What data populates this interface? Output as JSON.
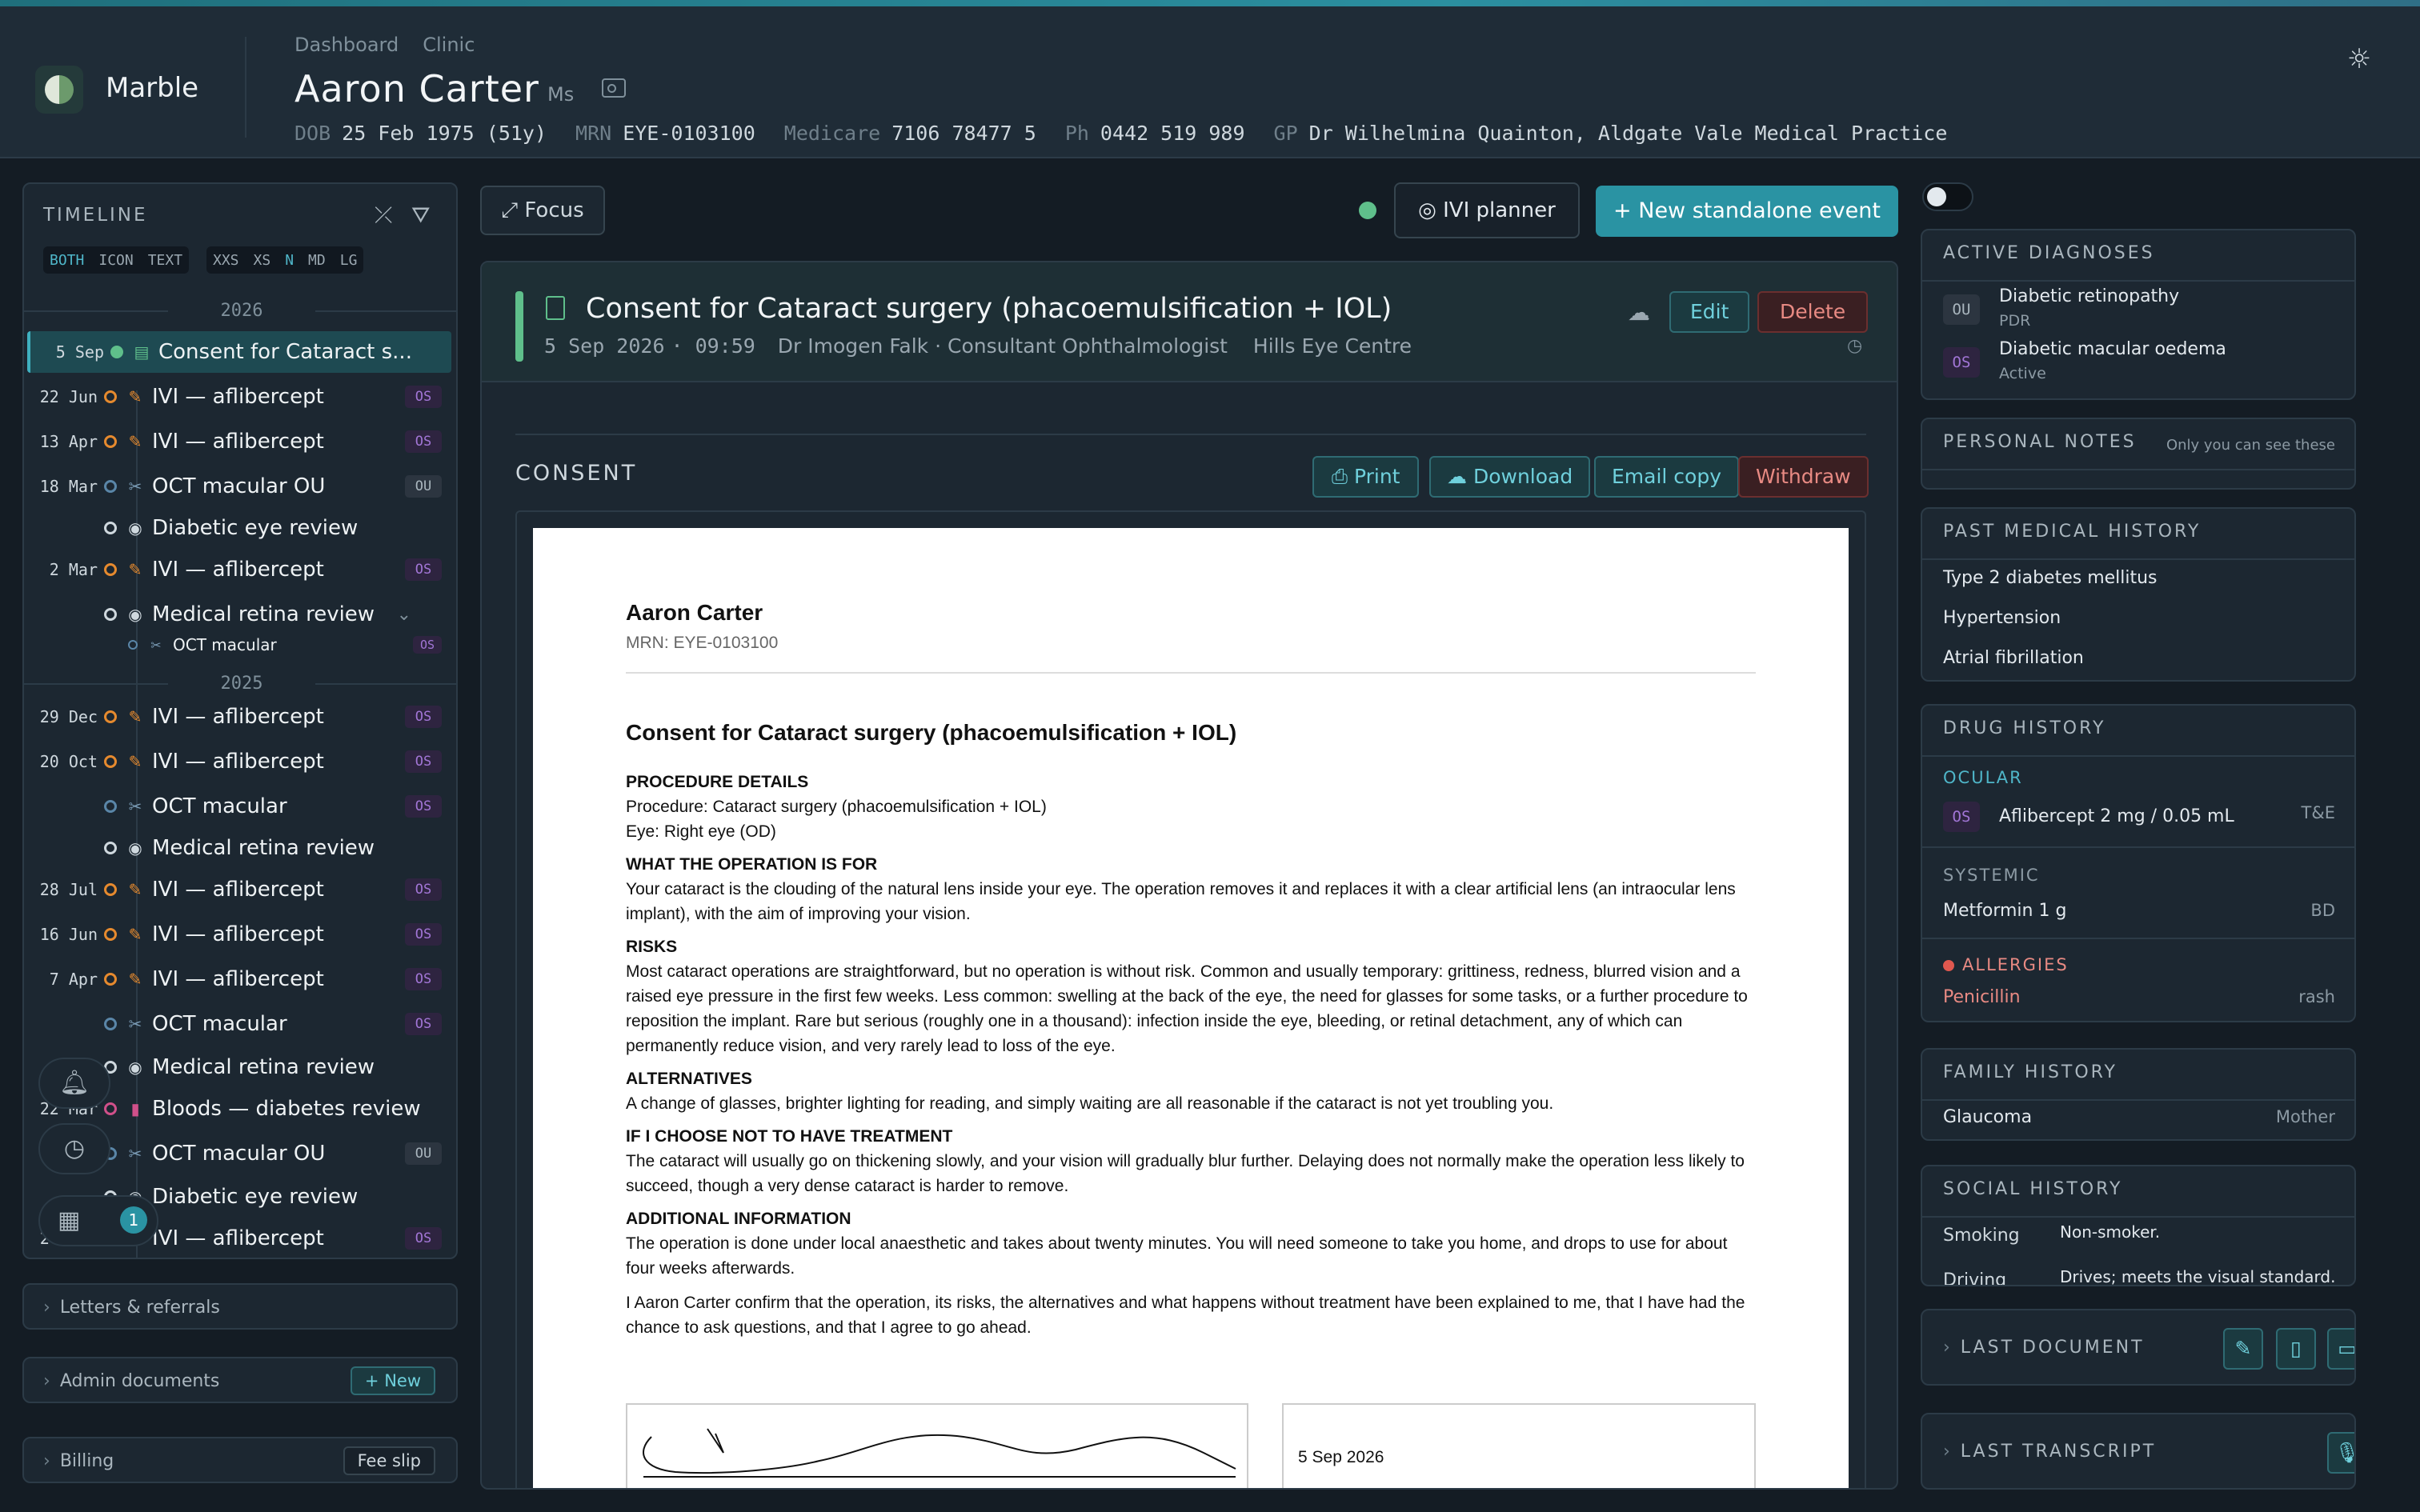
{
  "app": {
    "brand": "Marble",
    "breadcrumbs": [
      "Dashboard",
      "Clinic"
    ]
  },
  "patient": {
    "name": "Aaron Carter",
    "title": "Ms",
    "dob_k": "DOB",
    "dob": "25 Feb 1975 (51y)",
    "mrn_k": "MRN",
    "mrn": "EYE-0103100",
    "medicare_k": "Medicare",
    "medicare": "7106 78477 5",
    "ph_k": "Ph",
    "ph": "0442 519 989",
    "gp_k": "GP",
    "gp": "Dr Wilhelmina Quainton, Aldgate Vale Medical Practice"
  },
  "timeline": {
    "title": "TIMELINE",
    "modes": [
      "BOTH",
      "ICON",
      "TEXT"
    ],
    "sizes": [
      "XXS",
      "XS",
      "N",
      "MD",
      "LG"
    ],
    "year_2026": "2026",
    "year_2025": "2025",
    "rows": [
      {
        "d": "5 Sep",
        "label": "Consent for Cataract s...",
        "tag": ""
      },
      {
        "d": "22 Jun",
        "label": "IVI — aflibercept",
        "tag": "OS"
      },
      {
        "d": "13 Apr",
        "label": "IVI — aflibercept",
        "tag": "OS"
      },
      {
        "d": "18 Mar",
        "label": "OCT macular OU",
        "tag": "OU"
      },
      {
        "d": "",
        "label": "Diabetic eye review",
        "tag": ""
      },
      {
        "d": "2 Mar",
        "label": "IVI — aflibercept",
        "tag": "OS"
      },
      {
        "d": "",
        "label": "Medical retina review",
        "tag": ""
      },
      {
        "d": "",
        "label": "OCT macular",
        "tag": "OS"
      },
      {
        "d": "29 Dec",
        "label": "IVI — aflibercept",
        "tag": "OS"
      },
      {
        "d": "20 Oct",
        "label": "IVI — aflibercept",
        "tag": "OS"
      },
      {
        "d": "",
        "label": "OCT macular",
        "tag": "OS"
      },
      {
        "d": "",
        "label": "Medical retina review",
        "tag": ""
      },
      {
        "d": "28 Jul",
        "label": "IVI — aflibercept",
        "tag": "OS"
      },
      {
        "d": "16 Jun",
        "label": "IVI — aflibercept",
        "tag": "OS"
      },
      {
        "d": "7 Apr",
        "label": "IVI — aflibercept",
        "tag": "OS"
      },
      {
        "d": "",
        "label": "OCT macular",
        "tag": "OS"
      },
      {
        "d": "",
        "label": "Medical retina review",
        "tag": ""
      },
      {
        "d": "22 Mar",
        "label": "Bloods — diabetes review",
        "tag": ""
      },
      {
        "d": "",
        "label": "OCT macular OU",
        "tag": "OU"
      },
      {
        "d": "",
        "label": "Diabetic eye review",
        "tag": ""
      },
      {
        "d": "24 Feb",
        "label": "IVI — aflibercept",
        "tag": "OS"
      }
    ],
    "badge": "1"
  },
  "sections": {
    "letters": "Letters & referrals",
    "admin": "Admin documents",
    "admin_btn": "+ New",
    "billing": "Billing",
    "billing_btn": "Fee slip"
  },
  "toolbar": {
    "focus": "Focus",
    "ivi": "IVI planner",
    "new_event": "New standalone event"
  },
  "event": {
    "title": "Consent for Cataract surgery (phacoemulsification + IOL)",
    "date": "5 Sep 2026",
    "time": "09:59",
    "clinician": "Dr Imogen Falk · Consultant Ophthalmologist",
    "site": "Hills Eye Centre",
    "edit": "Edit",
    "delete": "Delete"
  },
  "consent": {
    "label": "CONSENT",
    "print": "Print",
    "download": "Download",
    "email": "Email copy",
    "withdraw": "Withdraw"
  },
  "doc": {
    "name": "Aaron Carter",
    "mrn": "MRN: EYE-0103100",
    "title": "Consent for Cataract surgery (phacoemulsification + IOL)",
    "h1": "PROCEDURE DETAILS",
    "p1a": "Procedure: Cataract surgery (phacoemulsification + IOL)",
    "p1b": "Eye: Right eye (OD)",
    "h2": "WHAT THE OPERATION IS FOR",
    "p2": "Your cataract is the clouding of the natural lens inside your eye. The operation removes it and replaces it with a clear artificial lens (an intraocular lens implant), with the aim of improving your vision.",
    "h3": "RISKS",
    "p3": "Most cataract operations are straightforward, but no operation is without risk. Common and usually temporary: grittiness, redness, blurred vision and a raised eye pressure in the first few weeks. Less common: swelling at the back of the eye, the need for glasses for some tasks, or a further procedure to reposition the implant. Rare but serious (roughly one in a thousand): infection inside the eye, bleeding, or retinal detachment, any of which can permanently reduce vision, and very rarely lead to loss of the eye.",
    "h4": "ALTERNATIVES",
    "p4": "A change of glasses, brighter lighting for reading, and simply waiting are all reasonable if the cataract is not yet troubling you.",
    "h5": "IF I CHOOSE NOT TO HAVE TREATMENT",
    "p5": "The cataract will usually go on thickening slowly, and your vision will gradually blur further. Delaying does not normally make the operation less likely to succeed, though a very dense cataract is harder to remove.",
    "h6": "ADDITIONAL INFORMATION",
    "p6": "The operation is done under local anaesthetic and takes about twenty minutes. You will need someone to take you home, and drops to use for about four weeks afterwards.",
    "p7": "I Aaron Carter confirm that the operation, its risks, the alternatives and what happens without treatment have been explained to me, that I have had the chance to ask questions, and that I agree to go ahead.",
    "sig_date": "5 Sep 2026"
  },
  "right": {
    "dx_title": "ACTIVE DIAGNOSES",
    "dx": [
      {
        "tag": "OU",
        "name": "Diabetic retinopathy",
        "sub": "PDR"
      },
      {
        "tag": "OS",
        "name": "Diabetic macular oedema",
        "sub": "Active"
      }
    ],
    "notes_title": "PERSONAL NOTES",
    "notes_hint": "Only you can see these",
    "pmh_title": "PAST MEDICAL HISTORY",
    "pmh": [
      "Type 2 diabetes mellitus",
      "Hypertension",
      "Atrial fibrillation"
    ],
    "drug_title": "DRUG HISTORY",
    "ocular": "OCULAR",
    "ocular_tag": "OS",
    "ocular_drug": "Aflibercept 2 mg / 0.05 mL",
    "ocular_freq": "T&E",
    "systemic": "SYSTEMIC",
    "sys_drug": "Metformin 1 g",
    "sys_freq": "BD",
    "allergies": "ALLERGIES",
    "allergen": "Penicillin",
    "reaction": "rash",
    "fh_title": "FAMILY HISTORY",
    "fh_item": "Glaucoma",
    "fh_rel": "Mother",
    "sh_title": "SOCIAL HISTORY",
    "sh": [
      {
        "k": "Smoking",
        "v": "Non-smoker."
      },
      {
        "k": "Driving",
        "v": "Drives; meets the visual standard."
      }
    ],
    "lastdoc": "LAST DOCUMENT",
    "lasttr": "LAST TRANSCRIPT"
  },
  "colors": {
    "accent": "#2a93a3",
    "ok": "#5fbf8b",
    "os": "#a276d6",
    "danger": "#e88a83",
    "warn": "#e68a2e"
  }
}
